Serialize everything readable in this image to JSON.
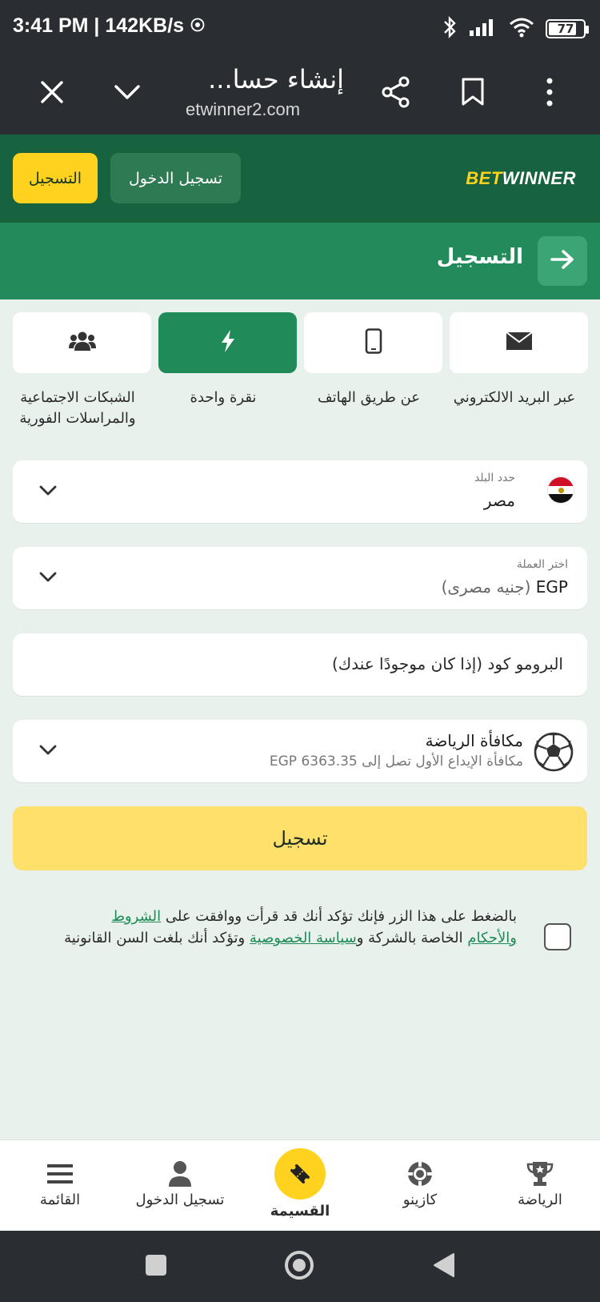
{
  "status_bar": {
    "time_speed": "3:41 PM | 142KB/s",
    "battery": "77"
  },
  "browser": {
    "page_title": "إنشاء حسا...",
    "url": "etwinner2.com"
  },
  "header": {
    "logo_bet": "BET",
    "logo_winner": "WINNER",
    "login_label": "تسجيل الدخول",
    "register_label": "التسجيل"
  },
  "title_strip": {
    "title": "التسجيل"
  },
  "tabs": [
    {
      "label": "عبر البريد الالكتروني",
      "icon": "envelope-icon"
    },
    {
      "label": "عن طريق الهاتف",
      "icon": "phone-icon"
    },
    {
      "label": "نقرة واحدة",
      "icon": "lightning-icon"
    },
    {
      "label": "الشبكات الاجتماعية والمراسلات الفورية",
      "icon": "users-icon"
    }
  ],
  "form": {
    "country_label": "حدد البلد",
    "country_value": "مصر",
    "currency_label": "اختر العملة",
    "currency_code": "EGP",
    "currency_name": "(جنيه مصرى)",
    "promo_placeholder": "البرومو كود (إذا كان موجودًا عندك)",
    "bonus_title": "مكافأة الرياضة",
    "bonus_sub": "مكافأة الإيداع الأول تصل إلى EGP 6363.35",
    "submit_label": "تسجيل"
  },
  "consent": {
    "part1": "بالضغط على هذا الزر فإنك تؤكد أنك قد قرأت ووافقت على ",
    "terms_link": "الشروط والأحكام",
    "part2": " الخاصة بالشركة و",
    "privacy_link": "سياسة الخصوصية",
    "part3": " وتؤكد أنك بلغت السن القانونية"
  },
  "bottom_nav": {
    "sports": "الرياضة",
    "casino": "كازينو",
    "coupon": "القسيمة",
    "login": "تسجيل الدخول",
    "menu": "القائمة"
  },
  "colors": {
    "header_green": "#17623f",
    "strip_green": "#238a5c",
    "accent_yellow": "#ffd21f",
    "submit_yellow": "#ffe06a",
    "background": "#e8f1ec"
  }
}
